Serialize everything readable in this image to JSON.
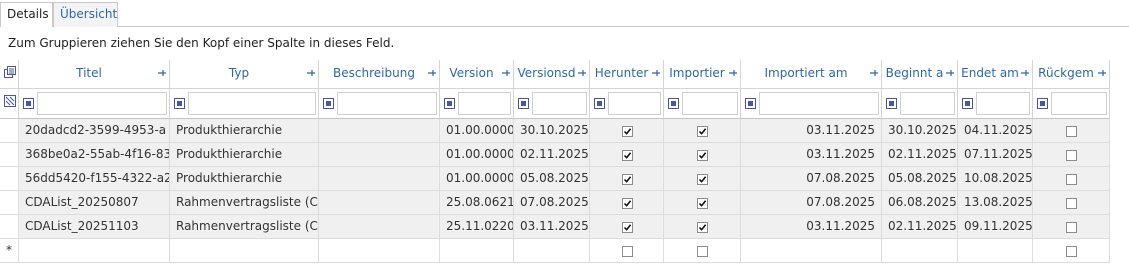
{
  "tabs": [
    {
      "label": "Details",
      "active": true
    },
    {
      "label": "Übersicht",
      "active": false
    }
  ],
  "group_panel": {
    "text": "Zum Gruppieren ziehen Sie den Kopf einer Spalte in dieses Feld."
  },
  "columns": [
    {
      "key": "titel",
      "label": "Titel"
    },
    {
      "key": "typ",
      "label": "Typ"
    },
    {
      "key": "beschreibung",
      "label": "Beschreibung"
    },
    {
      "key": "version",
      "label": "Version"
    },
    {
      "key": "versionsdatum",
      "label": "Versionsd"
    },
    {
      "key": "herunter",
      "label": "Herunter"
    },
    {
      "key": "importiert",
      "label": "Importier"
    },
    {
      "key": "importiert_am",
      "label": "Importiert am"
    },
    {
      "key": "beginnt",
      "label": "Beginnt a"
    },
    {
      "key": "endet",
      "label": "Endet am"
    },
    {
      "key": "rueckgem",
      "label": "Rückgem"
    }
  ],
  "rows": [
    {
      "titel": "20dadcd2-3599-4953-a",
      "typ": "Produkthierarchie",
      "beschreibung": "",
      "version": "01.00.0000",
      "versionsdatum": "30.10.2025",
      "herunter": true,
      "importiert": true,
      "importiert_am": "03.11.2025",
      "beginnt": "30.10.2025",
      "endet": "04.11.2025",
      "rueckgem": false
    },
    {
      "titel": "368be0a2-55ab-4f16-83",
      "typ": "Produkthierarchie",
      "beschreibung": "",
      "version": "01.00.0000",
      "versionsdatum": "02.11.2025",
      "herunter": true,
      "importiert": true,
      "importiert_am": "03.11.2025",
      "beginnt": "02.11.2025",
      "endet": "07.11.2025",
      "rueckgem": false
    },
    {
      "titel": "56dd5420-f155-4322-a2",
      "typ": "Produkthierarchie",
      "beschreibung": "",
      "version": "01.00.0000",
      "versionsdatum": "05.08.2025",
      "herunter": true,
      "importiert": true,
      "importiert_am": "07.08.2025",
      "beginnt": "05.08.2025",
      "endet": "10.08.2025",
      "rueckgem": false
    },
    {
      "titel": "CDAList_20250807",
      "typ": "Rahmenvertragsliste (C",
      "beschreibung": "",
      "version": "25.08.0621",
      "versionsdatum": "07.08.2025",
      "herunter": true,
      "importiert": true,
      "importiert_am": "07.08.2025",
      "beginnt": "06.08.2025",
      "endet": "13.08.2025",
      "rueckgem": false
    },
    {
      "titel": "CDAList_20251103",
      "typ": "Rahmenvertragsliste (C",
      "beschreibung": "",
      "version": "25.11.0220",
      "versionsdatum": "03.11.2025",
      "herunter": true,
      "importiert": true,
      "importiert_am": "03.11.2025",
      "beginnt": "02.11.2025",
      "endet": "09.11.2025",
      "rueckgem": false
    }
  ],
  "new_row": {
    "indicator": "*",
    "herunter": false,
    "importiert": false,
    "rueckgem": false
  }
}
